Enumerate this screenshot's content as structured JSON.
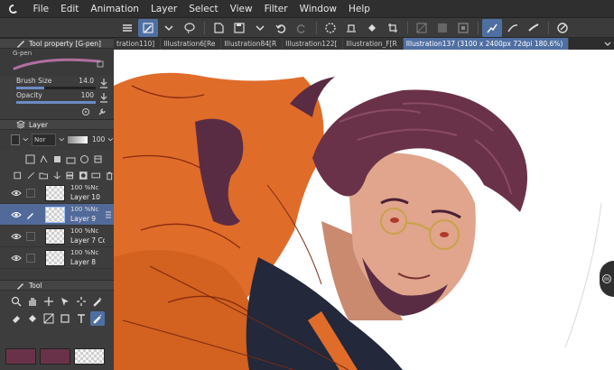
{
  "menu": {
    "items": [
      "File",
      "Edit",
      "Animation",
      "Layer",
      "Select",
      "View",
      "Filter",
      "Window",
      "Help"
    ]
  },
  "colors": {
    "accent": "#4f6fa3",
    "main_color": "#6a3248",
    "sub_color": "#6a3248"
  },
  "tool_property": {
    "title": "Tool property [G-pen]",
    "brush_name": "G-pen",
    "brush_size_label": "Brush Size",
    "brush_size_value": "14.0",
    "brush_size_fraction": 0.35,
    "opacity_label": "Opacity",
    "opacity_value": "100",
    "opacity_fraction": 1.0
  },
  "layer_panel": {
    "title": "Layer",
    "blend_mode": "Nor",
    "opacity": "100",
    "layers": [
      {
        "line1": "100 %Nc",
        "name": "Layer 10",
        "selected": false
      },
      {
        "line1": "100 %Nc",
        "name": "Layer 9",
        "selected": true
      },
      {
        "line1": "100 %Nc",
        "name": "Layer 7 Co",
        "selected": false
      },
      {
        "line1": "100 %Nc",
        "name": "Layer 8",
        "selected": false
      }
    ]
  },
  "tool_panel": {
    "title": "Tool"
  },
  "tabs": [
    {
      "label": "tration110]",
      "active": false
    },
    {
      "label": "Illustration6[Re",
      "active": false
    },
    {
      "label": "Illustration84[R",
      "active": false
    },
    {
      "label": "Illustration122[",
      "active": false
    },
    {
      "label": "Illustration_F[R",
      "active": false
    },
    {
      "label": "Illustration137 (3100 x 2400px 72dpi 180.6%)",
      "active": true
    }
  ],
  "icons": {
    "app": "clip-studio-icon",
    "handle": "side-panel-handle-icon"
  }
}
